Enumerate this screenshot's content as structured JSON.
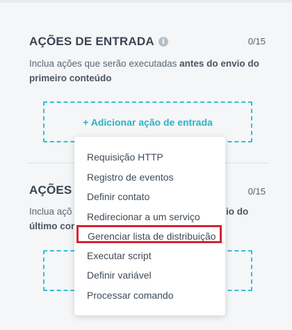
{
  "entrada": {
    "title": "AÇÕES DE ENTRADA",
    "counter": "0/15",
    "desc_prefix": "Inclua ações que serão executadas ",
    "desc_bold": "antes do envio do primeiro conteúdo",
    "add_label": "+ Adicionar ação de entrada"
  },
  "saida": {
    "title_visible": "AÇÕES D",
    "counter": "0/15",
    "desc_line1_left": "Inclua açõ",
    "desc_line1_right": "io do",
    "desc_line2_left": "último con"
  },
  "menu": {
    "items": [
      "Requisição HTTP",
      "Registro de eventos",
      "Definir contato",
      "Redirecionar a um serviço",
      "Gerenciar lista de distribuição",
      "Executar script",
      "Definir variável",
      "Processar comando"
    ],
    "highlighted_index": 4,
    "highlight_color": "#d62232"
  },
  "colors": {
    "accent": "#2bb3c2",
    "background": "#f4f6f8"
  }
}
